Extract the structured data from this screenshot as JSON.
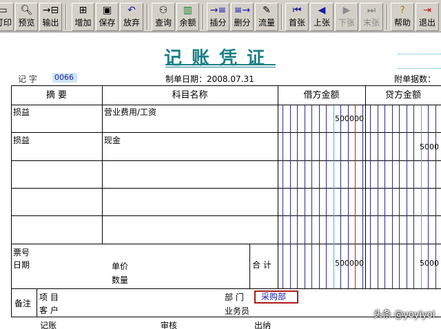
{
  "toolbar": {
    "buttons": [
      {
        "label": "打印",
        "icon": "print-icon"
      },
      {
        "label": "预览",
        "icon": "preview-icon"
      },
      {
        "label": "输出",
        "icon": "export-icon"
      },
      {
        "label": "增加",
        "icon": "add-icon"
      },
      {
        "label": "保存",
        "icon": "save-icon"
      },
      {
        "label": "放弃",
        "icon": "undo-icon"
      },
      {
        "label": "查询",
        "icon": "binoculars-icon"
      },
      {
        "label": "余额",
        "icon": "balance-chart-icon"
      },
      {
        "label": "插分",
        "icon": "insert-split-icon"
      },
      {
        "label": "删分",
        "icon": "delete-split-icon"
      },
      {
        "label": "流量",
        "icon": "cashflow-icon"
      },
      {
        "label": "首张",
        "icon": "first-icon"
      },
      {
        "label": "上张",
        "icon": "prev-icon"
      },
      {
        "label": "下张",
        "icon": "next-icon"
      },
      {
        "label": "末张",
        "icon": "last-icon"
      },
      {
        "label": "帮助",
        "icon": "help-icon"
      },
      {
        "label": "退出",
        "icon": "exit-icon"
      }
    ]
  },
  "voucher": {
    "title": "记账凭证",
    "type_label": "记  字",
    "number": "0066",
    "date_label": "制单日期：",
    "date": "2008.07.31",
    "attachments_label": "附单据数：",
    "columns": {
      "summary": "摘  要",
      "account": "科目名称",
      "debit": "借方金额",
      "credit": "贷方金额"
    },
    "rows": [
      {
        "summary": "损益",
        "account": "营业费用/工资",
        "debit": "500000",
        "credit": ""
      },
      {
        "summary": "损益",
        "account": "现金",
        "debit": "",
        "credit": "5000"
      },
      {
        "summary": "",
        "account": "",
        "debit": "",
        "credit": ""
      },
      {
        "summary": "",
        "account": "",
        "debit": "",
        "credit": ""
      },
      {
        "summary": "",
        "account": "",
        "debit": "",
        "credit": ""
      }
    ],
    "bottom": {
      "ticket_label": "票号",
      "date_label": "日期",
      "unit_price_label": "单价",
      "quantity_label": "数量",
      "total_label": "合 计",
      "total_debit": "500000",
      "total_credit": "5000"
    },
    "remarks": {
      "label": "备注",
      "project_label": "项  目",
      "customer_label": "客  户",
      "department_label": "部  门",
      "department_value": "采购部",
      "salesperson_label": "业务员"
    },
    "signers": {
      "bookkeeper": "记账",
      "reviewer": "审核",
      "cashier": "出纳"
    }
  },
  "watermark": "头条 @yoyiyoi"
}
